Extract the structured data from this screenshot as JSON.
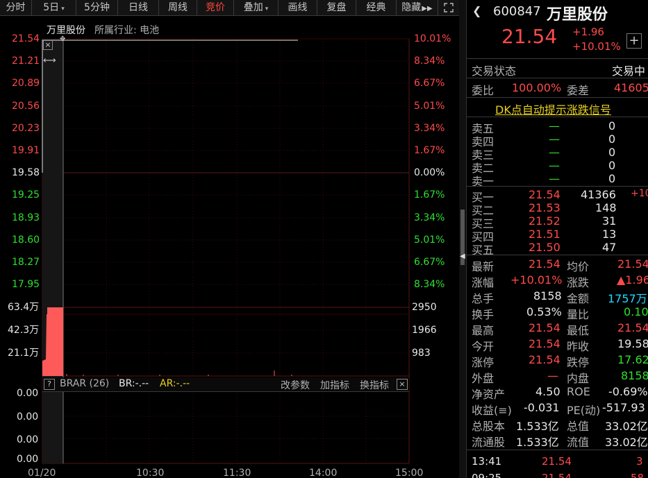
{
  "toolbar": {
    "items": [
      "分时",
      "5日",
      "5分钟",
      "日线",
      "周线",
      "竞价",
      "叠加",
      "画线",
      "复盘",
      "经典",
      "隐藏"
    ],
    "active": "竞价"
  },
  "chart": {
    "stock_name": "万里股份",
    "industry_label": "所属行业: 电池",
    "price_ticks": [
      "21.54",
      "21.21",
      "20.89",
      "20.56",
      "20.23",
      "19.91",
      "19.58",
      "19.25",
      "18.93",
      "18.60",
      "18.27",
      "17.95"
    ],
    "pct_ticks": [
      "10.01%",
      "8.34%",
      "6.67%",
      "5.01%",
      "3.34%",
      "1.67%",
      "0.00%",
      "1.67%",
      "3.34%",
      "5.01%",
      "6.67%",
      "8.34%"
    ],
    "volume_ticks_left": [
      "63.4万",
      "42.3万",
      "21.1万"
    ],
    "volume_ticks_right": [
      "2950",
      "1966",
      "983"
    ],
    "indicator": {
      "help": "?",
      "name": "BRAR (26)",
      "br": "BR:-.--",
      "ar": "AR:-.--",
      "change_params": "改参数",
      "add_indicator": "加指标",
      "switch_indicator": "换指标",
      "ticks": [
        "0.00",
        "0.00",
        "0.00",
        "0.00"
      ]
    },
    "time_ticks": [
      "01/20",
      "10:30",
      "11:30",
      "14:00",
      "15:00"
    ]
  },
  "panel": {
    "code": "600847",
    "name": "万里股份",
    "price": "21.54",
    "change": "+1.96",
    "change_pct": "+10.01%",
    "status_label": "交易状态",
    "status_value": "交易中",
    "wei_bi_label": "委比",
    "wei_bi": "100.00%",
    "wei_cha_label": "委差",
    "wei_cha": "41605",
    "dk_signal": "DK点自动提示涨跌信号",
    "sell": [
      {
        "label": "卖五",
        "price": "—",
        "vol": "0"
      },
      {
        "label": "卖四",
        "price": "—",
        "vol": "0"
      },
      {
        "label": "卖三",
        "price": "—",
        "vol": "0"
      },
      {
        "label": "卖二",
        "price": "—",
        "vol": "0"
      },
      {
        "label": "卖一",
        "price": "—",
        "vol": "0"
      }
    ],
    "buy": [
      {
        "label": "买一",
        "price": "21.54",
        "vol": "41366",
        "extra": "+10"
      },
      {
        "label": "买二",
        "price": "21.53",
        "vol": "148",
        "extra": ""
      },
      {
        "label": "买三",
        "price": "21.52",
        "vol": "31",
        "extra": ""
      },
      {
        "label": "买四",
        "price": "21.51",
        "vol": "13",
        "extra": ""
      },
      {
        "label": "买五",
        "price": "21.50",
        "vol": "47",
        "extra": ""
      }
    ],
    "stats": [
      {
        "l1": "最新",
        "v1": "21.54",
        "c1": "red",
        "l2": "均价",
        "v2": "21.54",
        "c2": "red"
      },
      {
        "l1": "涨幅",
        "v1": "+10.01%",
        "c1": "red",
        "l2": "涨跌",
        "v2": "▲1.96",
        "c2": "red"
      },
      {
        "l1": "总手",
        "v1": "8158",
        "c1": "white",
        "l2": "金额",
        "v2": "1757万",
        "c2": "cyan"
      },
      {
        "l1": "换手",
        "v1": "0.53%",
        "c1": "white",
        "l2": "量比",
        "v2": "0.10",
        "c2": "green"
      },
      {
        "l1": "最高",
        "v1": "21.54",
        "c1": "red",
        "l2": "最低",
        "v2": "21.54",
        "c2": "red"
      },
      {
        "l1": "今开",
        "v1": "21.54",
        "c1": "red",
        "l2": "昨收",
        "v2": "19.58",
        "c2": "white"
      },
      {
        "l1": "涨停",
        "v1": "21.54",
        "c1": "red",
        "l2": "跌停",
        "v2": "17.62",
        "c2": "green"
      },
      {
        "l1": "外盘",
        "v1": "—",
        "c1": "red",
        "l2": "内盘",
        "v2": "8158",
        "c2": "green"
      },
      {
        "l1": "净资产",
        "v1": "4.50",
        "c1": "white",
        "l2": "ROE",
        "v2": "-0.69%",
        "c2": "white"
      },
      {
        "l1": "收益(≡)",
        "v1": "-0.031",
        "c1": "white",
        "l2": "PE(动)",
        "v2": "-517.93",
        "c2": "white"
      },
      {
        "l1": "总股本",
        "v1": "1.533亿",
        "c1": "white",
        "l2": "总值",
        "v2": "33.02亿",
        "c2": "white"
      },
      {
        "l1": "流通股",
        "v1": "1.533亿",
        "c1": "white",
        "l2": "流值",
        "v2": "33.02亿",
        "c2": "white"
      }
    ],
    "ticks": [
      {
        "time": "13:41",
        "price": "21.54",
        "vol": "3"
      },
      {
        "time": "09:25",
        "price": "21.54",
        "vol": "58"
      }
    ]
  },
  "colors": {
    "up": "#ff4a4a",
    "down": "#2ee02e",
    "accent": "#ff4a3a"
  }
}
